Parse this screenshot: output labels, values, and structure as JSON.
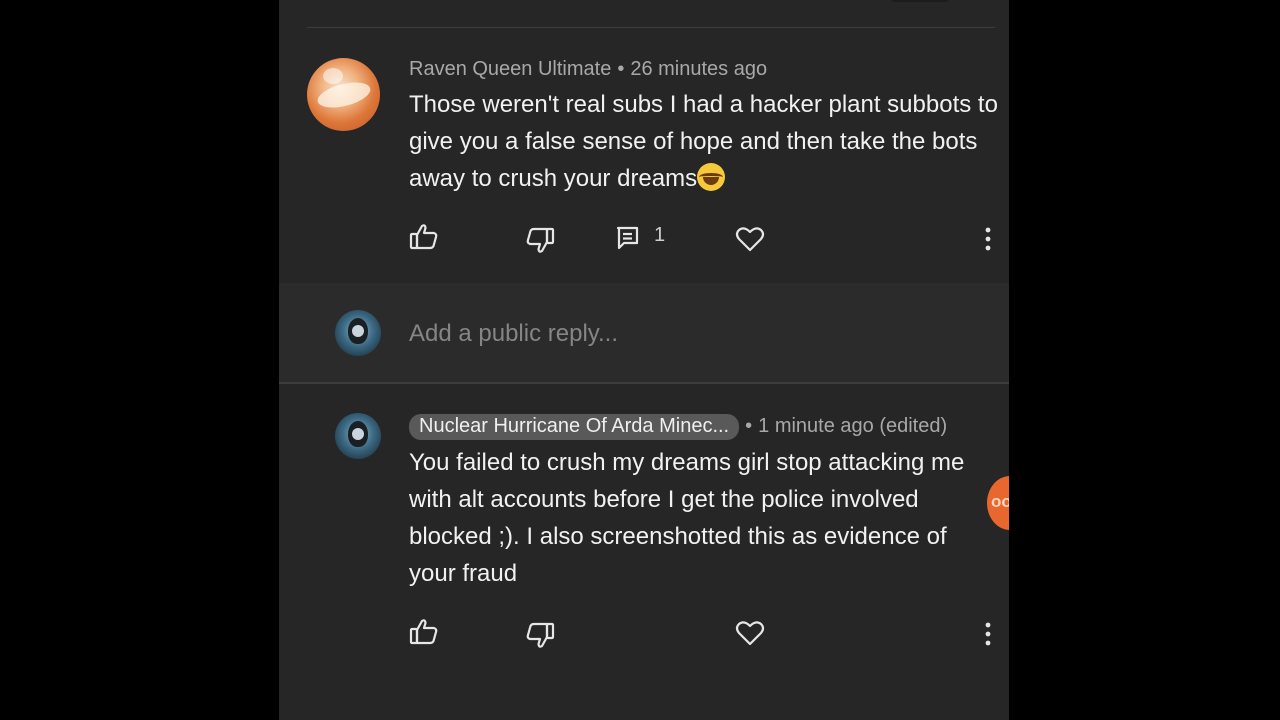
{
  "colors": {
    "page_background": "#000000",
    "panel_background": "#262626",
    "reply_box_background": "#2b2b2b",
    "author_chip_background": "#595959",
    "badge_orange": "#e8672e"
  },
  "comments": [
    {
      "author": "Raven Queen Ultimate",
      "timestamp": "26 minutes ago",
      "avatar": "orange-abstract-avatar",
      "body": "Those weren't real subs I had a hacker plant subbots to give you a false sense of hope and then take the bots away to crush your dreams",
      "emoji": "face-with-tears-of-joy",
      "reply_count": "1",
      "actions": [
        "thumb-up-icon",
        "thumb-down-icon",
        "reply-icon",
        "heart-icon",
        "more-vert-icon"
      ]
    },
    {
      "author": "Nuclear Hurricane Of Arda Minec...",
      "timestamp": "1 minute ago (edited)",
      "avatar": "user-profile-avatar",
      "body": "You failed to crush my dreams girl stop attacking me with alt accounts before I get the police involved blocked ;). I also screenshotted this as evidence of your fraud",
      "actions": [
        "thumb-up-icon",
        "thumb-down-icon",
        "heart-icon",
        "more-vert-icon"
      ]
    }
  ],
  "reply_box": {
    "placeholder": "Add a public reply...",
    "avatar": "user-profile-avatar"
  },
  "separator": "•",
  "edge_badge": {
    "text": "oo"
  }
}
